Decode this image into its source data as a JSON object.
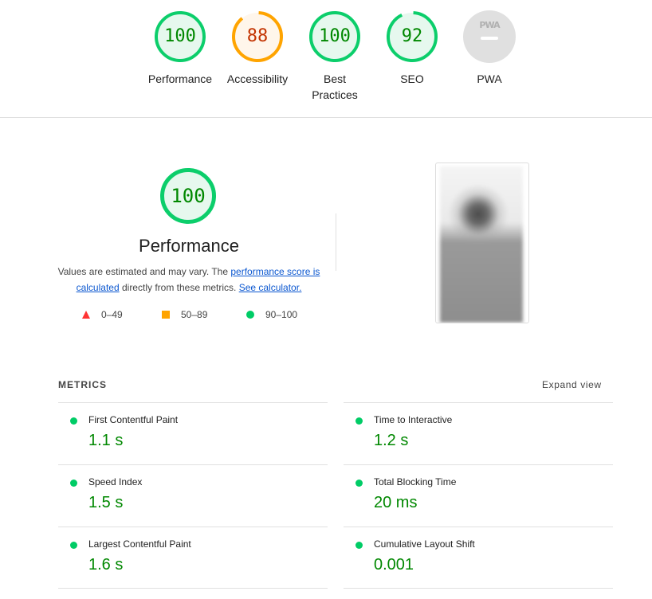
{
  "colors": {
    "pass": "#0cce6b",
    "pass_text": "#008800",
    "pass_fill": "#e6f8ee",
    "average": "#ffa400",
    "average_text": "#c33300",
    "average_fill": "#fff6eb",
    "fail": "#ff3333",
    "na": "#e0e0e0",
    "link": "#0b57d0"
  },
  "category_gauges": [
    {
      "label": "Performance",
      "score": 100,
      "status": "pass"
    },
    {
      "label": "Accessibility",
      "score": 88,
      "status": "average"
    },
    {
      "label": "Best Practices",
      "score": 100,
      "status": "pass"
    },
    {
      "label": "SEO",
      "score": 92,
      "status": "pass"
    },
    {
      "label": "PWA",
      "score": null,
      "status": "na",
      "badge_text": "PWA",
      "icon": "pwa-badge-icon"
    }
  ],
  "performance": {
    "score": 100,
    "title": "Performance",
    "desc_prefix": "Values are estimated and may vary. The ",
    "link1": "performance score is calculated",
    "desc_middle": " directly from these metrics. ",
    "link2": "See calculator.",
    "legend": [
      {
        "icon": "triangle-fail-icon",
        "range": "0–49"
      },
      {
        "icon": "square-average-icon",
        "range": "50–89"
      },
      {
        "icon": "circle-pass-icon",
        "range": "90–100"
      }
    ],
    "screenshot_icon": "final-screenshot-thumbnail"
  },
  "metrics": {
    "header": "METRICS",
    "expand_label": "Expand view",
    "items": [
      {
        "title": "First Contentful Paint",
        "value": "1.1 s"
      },
      {
        "title": "Time to Interactive",
        "value": "1.2 s"
      },
      {
        "title": "Speed Index",
        "value": "1.5 s"
      },
      {
        "title": "Total Blocking Time",
        "value": "20 ms"
      },
      {
        "title": "Largest Contentful Paint",
        "value": "1.6 s"
      },
      {
        "title": "Cumulative Layout Shift",
        "value": "0.001"
      }
    ]
  }
}
